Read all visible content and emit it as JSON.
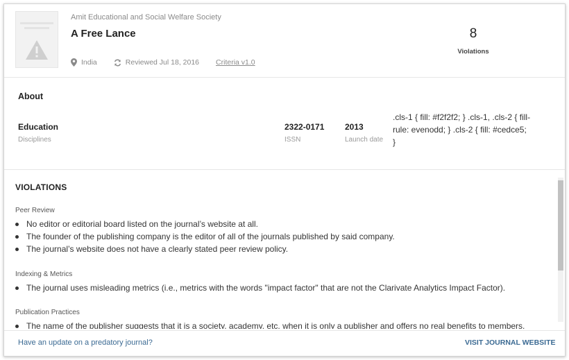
{
  "header": {
    "society": "Amit Educational and Social Welfare Society",
    "title": "A Free Lance",
    "country": "India",
    "reviewed": "Reviewed Jul 18, 2016",
    "criteria": "Criteria v1.0",
    "violations_count": "8",
    "violations_label": "Violations"
  },
  "about": {
    "title": "About",
    "discipline_value": "Education",
    "discipline_label": "Disciplines",
    "issn_value": "2322-0171",
    "issn_label": "ISSN",
    "launch_value": "2013",
    "launch_label": "Launch date",
    "stray_css": ".cls-1 { fill: #f2f2f2; } .cls-1, .cls-2 { fill-rule: evenodd; } .cls-2 { fill: #cedce5; }"
  },
  "violations": {
    "title": "VIOLATIONS",
    "categories": [
      {
        "name": "Peer Review",
        "items": [
          "No editor or editorial board listed on the journal’s website at all.",
          "The founder of the publishing company is the editor of all of the journals published by said company.",
          "The journal’s website does not have a clearly stated peer review policy."
        ]
      },
      {
        "name": "Indexing & Metrics",
        "items": [
          "The journal uses misleading metrics (i.e., metrics with the words \"impact factor\" that are not the Clarivate Analytics Impact Factor)."
        ]
      },
      {
        "name": "Publication Practices",
        "items": [
          "The name of the publisher suggests that it is a society, academy, etc. when it is only a publisher and offers no real benefits to members."
        ]
      }
    ]
  },
  "footer": {
    "update_link": "Have an update on a predatory journal?",
    "visit_link": "VISIT JOURNAL WEBSITE"
  },
  "colors": {
    "link": "#3b6a93",
    "placeholder_bg": "#f2f2f2",
    "placeholder_icon": "#cfcfcf"
  },
  "icons": {
    "placeholder": "warning-triangle-icon",
    "country": "map-pin-icon",
    "reviewed": "refresh-icon"
  }
}
